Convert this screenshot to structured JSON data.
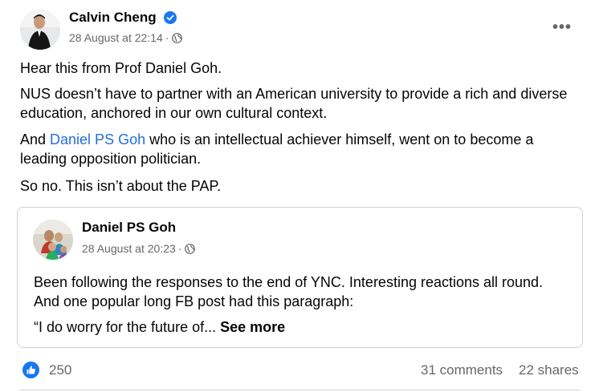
{
  "post": {
    "author": "Calvin Cheng",
    "verified_icon": "verified-badge-icon",
    "timestamp": "28 August at 22:14",
    "separator": "·",
    "audience_icon": "globe-icon",
    "more_icon": "more-options-icon",
    "more_label": "•••",
    "paragraphs": {
      "p1": "Hear this from Prof Daniel Goh.",
      "p2": "NUS doesn’t have to partner with an American university to provide a rich and diverse education, anchored in our own cultural context.",
      "p3_prefix": "And ",
      "p3_link": "Daniel PS Goh",
      "p3_suffix": " who is an intellectual achiever himself, went on to become a leading opposition politician.",
      "p4": "So no. This isn’t about the PAP."
    }
  },
  "shared": {
    "author": "Daniel PS Goh",
    "timestamp": "28 August at 20:23",
    "separator": "·",
    "audience_icon": "globe-icon",
    "text": "Been following the responses to the end of YNC. Interesting reactions all round. And one popular long FB post had this paragraph:",
    "quote": "“I do worry for the future of... ",
    "see_more": "See more"
  },
  "footer": {
    "like_icon": "thumbs-up-icon",
    "like_count": "250",
    "comments": "31 comments",
    "shares": "22 shares"
  },
  "colors": {
    "link": "#216fdb",
    "secondary_text": "#65676b",
    "like_blue": "#1877f2",
    "verified_blue": "#1877f2"
  }
}
